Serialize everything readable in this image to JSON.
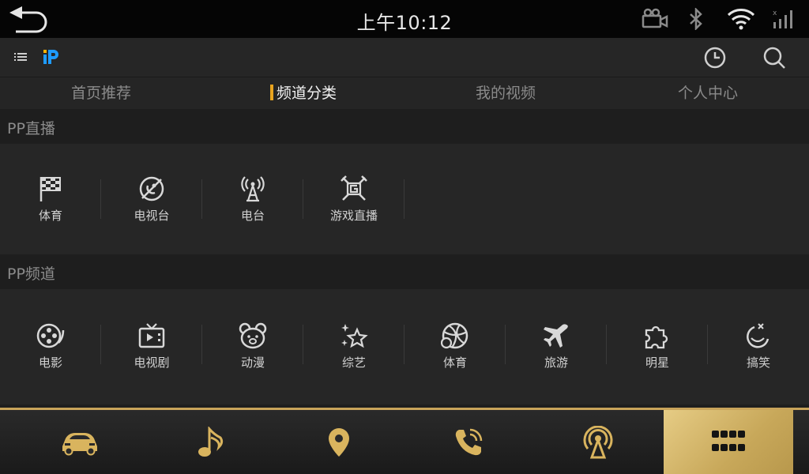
{
  "status": {
    "time": "上午10:12"
  },
  "tabs": [
    {
      "label": "首页推荐",
      "active": false
    },
    {
      "label": "频道分类",
      "active": true
    },
    {
      "label": "我的视频",
      "active": false
    },
    {
      "label": "个人中心",
      "active": false
    }
  ],
  "live": {
    "title": "PP直播",
    "items": [
      {
        "label": "体育",
        "icon": "checkered-flag-icon"
      },
      {
        "label": "电视台",
        "icon": "satellite-dish-icon"
      },
      {
        "label": "电台",
        "icon": "radio-tower-icon"
      },
      {
        "label": "游戏直播",
        "icon": "game-icon"
      }
    ]
  },
  "channels": {
    "title": "PP频道",
    "items": [
      {
        "label": "电影",
        "icon": "film-reel-icon"
      },
      {
        "label": "电视剧",
        "icon": "tv-icon"
      },
      {
        "label": "动漫",
        "icon": "bear-face-icon"
      },
      {
        "label": "综艺",
        "icon": "stars-icon"
      },
      {
        "label": "体育",
        "icon": "basketball-icon"
      },
      {
        "label": "旅游",
        "icon": "airplane-icon"
      },
      {
        "label": "明星",
        "icon": "puzzle-icon"
      },
      {
        "label": "搞笑",
        "icon": "laugh-face-icon"
      }
    ]
  },
  "colors": {
    "accent": "#e8a41e",
    "gold": "#c9a45a",
    "dock_icon": "#d9b45e"
  },
  "dock": [
    {
      "icon": "car-icon",
      "active": false
    },
    {
      "icon": "music-note-icon",
      "active": false
    },
    {
      "icon": "location-pin-icon",
      "active": false
    },
    {
      "icon": "phone-icon",
      "active": false
    },
    {
      "icon": "signal-tower-icon",
      "active": false
    },
    {
      "icon": "apps-grid-icon",
      "active": true
    }
  ]
}
